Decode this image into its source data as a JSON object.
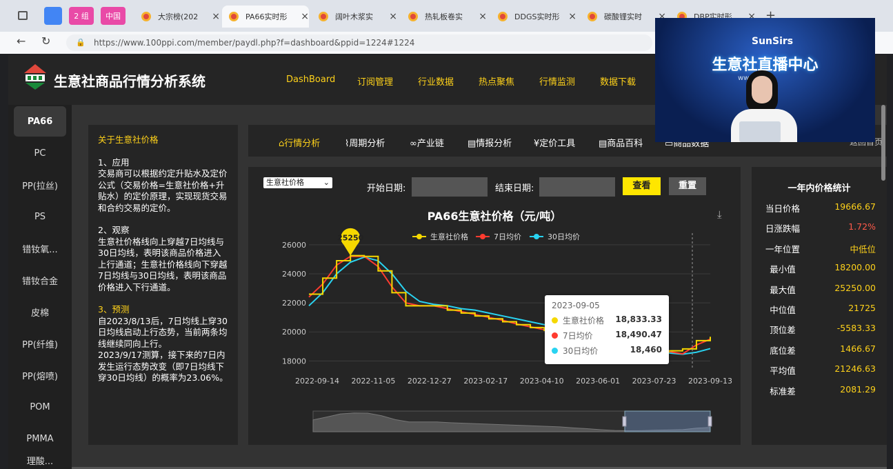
{
  "browser": {
    "tabs": [
      {
        "label": "2 组",
        "type": "group",
        "color": "#e94aa7"
      },
      {
        "label": "中国",
        "type": "group",
        "color": "#e94aa7"
      },
      {
        "label": "大宗榜(202"
      },
      {
        "label": "PA66实时形",
        "active": true
      },
      {
        "label": "阔叶木浆实"
      },
      {
        "label": "热轧板卷实"
      },
      {
        "label": "DDGS实时形"
      },
      {
        "label": "碳酸锂实时"
      },
      {
        "label": "DBP实时形"
      }
    ],
    "url": "https://www.100ppi.com/member/paydl.php?f=dashboard&ppid=1224#1224",
    "new_tab": "+"
  },
  "header": {
    "brand": "生意社商品行情分析系统",
    "nav": [
      "DashBoard",
      "订阅管理",
      "行业数据",
      "热点聚焦",
      "行情监测",
      "数据下载"
    ]
  },
  "sidebar": {
    "items": [
      "PA66",
      "PC",
      "PP(拉丝)",
      "PS",
      "错钕氧...",
      "错钕合金",
      "皮棉",
      "PP(纤维)",
      "PP(熔喷)",
      "POM",
      "PMMA",
      "理酸..."
    ]
  },
  "about": {
    "title": "关于生意社价格",
    "s1_title": "1、应用",
    "s1_body": "交易商可以根据约定升贴水及定价公式（交易价格=生意社价格+升贴水）的定价原理，实现现货交易和合约交易的定价。",
    "s2_title": "2、观察",
    "s2_body": "生意社价格线向上穿越7日均线与30日均线，表明该商品价格进入上行通道；生意社价格线向下穿越7日均线与30日均线，表明该商品价格进入下行通道。",
    "s3_title": "3、预测",
    "s3_body1": "自2023/8/13后，7日均线上穿30日均线启动上行态势，当前两条均线继续同向上行。",
    "s3_body2": "2023/9/17测算，接下来的7日内发生运行态势改变（即7日均线下穿30日均线）的概率为23.06%。"
  },
  "tools": [
    "行情分析",
    "周期分析",
    "产业链",
    "情报分析",
    "定价工具",
    "商品百科",
    "商品数据",
    "返回首页"
  ],
  "controls": {
    "select": "生意社价格",
    "start_label": "开始日期:",
    "end_label": "结束日期:",
    "query": "查看",
    "reset": "重置"
  },
  "chart_data": {
    "type": "line",
    "title": "PA66生意社价格（元/吨）",
    "x_ticks": [
      "2022-09-14",
      "2022-11-05",
      "2022-12-27",
      "2023-02-17",
      "2023-04-10",
      "2023-06-01",
      "2023-07-23",
      "2023-09-13"
    ],
    "y_ticks": [
      18000,
      20000,
      22000,
      24000,
      26000
    ],
    "ylim": [
      17400,
      26800
    ],
    "legend": [
      "生意社价格",
      "7日均价",
      "30日均价"
    ],
    "colors": [
      "#f5d800",
      "#ff3b2f",
      "#29d3f1"
    ],
    "series": [
      {
        "name": "生意社价格",
        "values": [
          22600,
          23700,
          24900,
          25250,
          25200,
          24200,
          22700,
          21800,
          21800,
          21800,
          21500,
          21300,
          21100,
          20900,
          20700,
          20500,
          20300,
          20100,
          19900,
          19500,
          19200,
          18800,
          18500,
          18400,
          18450,
          18600,
          18700,
          18833,
          19400,
          19666
        ]
      },
      {
        "name": "7日均价",
        "values": [
          22400,
          23300,
          24600,
          25200,
          25200,
          24500,
          23100,
          22000,
          21800,
          21800,
          21600,
          21400,
          21200,
          21000,
          20800,
          20550,
          20350,
          20150,
          19950,
          19600,
          19300,
          18950,
          18650,
          18500,
          18480,
          18550,
          18650,
          18490,
          19100,
          19500
        ]
      },
      {
        "name": "30日均价",
        "values": [
          21800,
          22700,
          24000,
          24800,
          25150,
          24900,
          24000,
          22800,
          22100,
          21900,
          21800,
          21600,
          21500,
          21300,
          21100,
          20900,
          20700,
          20500,
          20300,
          20050,
          19800,
          19500,
          19250,
          19000,
          18800,
          18650,
          18550,
          18460,
          18600,
          18850
        ]
      }
    ],
    "peak_label": "25250",
    "tooltip": {
      "date": "2023-09-05",
      "rows": [
        {
          "name": "生意社价格",
          "value": "18,833.33"
        },
        {
          "name": "7日均价",
          "value": "18,490.47"
        },
        {
          "name": "30日均价",
          "value": "18,460"
        }
      ]
    }
  },
  "stats": {
    "title": "一年内价格统计",
    "rows": [
      {
        "label": "当日价格",
        "value": "19666.67"
      },
      {
        "label": "日涨跌幅",
        "value": "1.72%",
        "color": "#ff5a4a"
      },
      {
        "label": "一年位置",
        "value": "中低位"
      },
      {
        "label": "最小值",
        "value": "18200.00"
      },
      {
        "label": "最大值",
        "value": "25250.00"
      },
      {
        "label": "中位值",
        "value": "21725"
      },
      {
        "label": "顶位差",
        "value": "-5583.33"
      },
      {
        "label": "底位差",
        "value": "1466.67"
      },
      {
        "label": "平均值",
        "value": "21246.63"
      },
      {
        "label": "标准差",
        "value": "2081.29"
      }
    ]
  },
  "video": {
    "logo": "SunSirs",
    "title": "生意社直播中心",
    "site": "www.1"
  }
}
